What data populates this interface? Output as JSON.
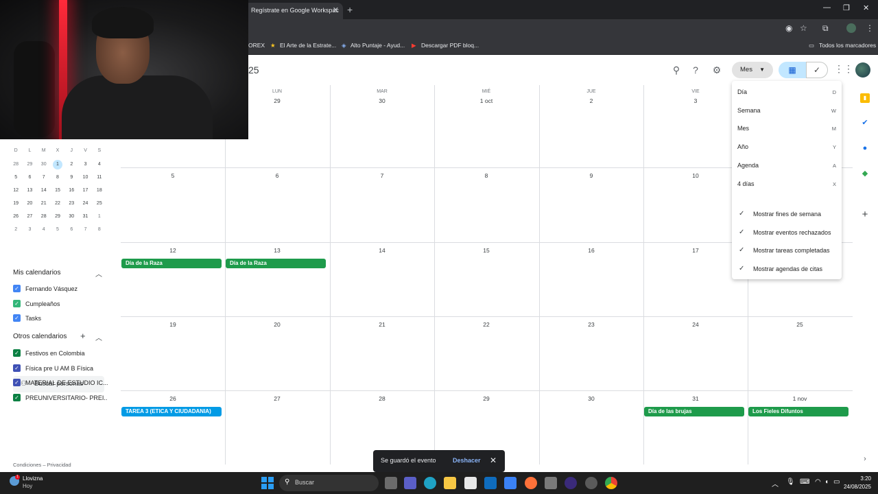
{
  "browser": {
    "active_tab_title": "Regístrate en Google Workspac",
    "bookmarks": [
      "OREX",
      "El Arte de la Estrate...",
      "Alto Puntaje - Ayud...",
      "Descargar PDF bloq..."
    ],
    "all_bookmarks": "Todos los marcadores"
  },
  "header": {
    "year_fragment": "25",
    "view_button": "Mes"
  },
  "mini_calendar": {
    "dow": [
      "D",
      "L",
      "M",
      "X",
      "J",
      "V",
      "S"
    ],
    "weeks": [
      [
        "28",
        "29",
        "30",
        "1",
        "2",
        "3",
        "4"
      ],
      [
        "5",
        "6",
        "7",
        "8",
        "9",
        "10",
        "11"
      ],
      [
        "12",
        "13",
        "14",
        "15",
        "16",
        "17",
        "18"
      ],
      [
        "19",
        "20",
        "21",
        "22",
        "23",
        "24",
        "25"
      ],
      [
        "26",
        "27",
        "28",
        "29",
        "30",
        "31",
        "1"
      ],
      [
        "2",
        "3",
        "4",
        "5",
        "6",
        "7",
        "8"
      ]
    ]
  },
  "sidebar": {
    "people_search": "Buscar personas",
    "my_calendars_title": "Mis calendarios",
    "my_calendars": [
      {
        "label": "Fernando Vásquez",
        "color": "#4285f4"
      },
      {
        "label": "Cumpleaños",
        "color": "#33b679"
      },
      {
        "label": "Tasks",
        "color": "#4285f4"
      }
    ],
    "other_calendars_title": "Otros calendarios",
    "other_calendars": [
      {
        "label": "Festivos en Colombia",
        "color": "#0b8043"
      },
      {
        "label": "Física pre U AM B Física",
        "color": "#3f51b5"
      },
      {
        "label": "MATERIAL DE ESTUDIO IC...",
        "color": "#3f51b5"
      },
      {
        "label": "PREUNIVERSITARIO- PREI...",
        "color": "#0b8043"
      }
    ],
    "footer": "Condiciones – Privacidad"
  },
  "grid": {
    "dow": [
      "",
      "LUN",
      "MAR",
      "MIÉ",
      "JUE",
      "VIE",
      ""
    ],
    "weeks": [
      [
        "",
        "29",
        "30",
        "1 oct",
        "2",
        "3",
        ""
      ],
      [
        "5",
        "6",
        "7",
        "8",
        "9",
        "10",
        ""
      ],
      [
        "12",
        "13",
        "14",
        "15",
        "16",
        "17",
        ""
      ],
      [
        "19",
        "20",
        "21",
        "22",
        "23",
        "24",
        "25"
      ],
      [
        "26",
        "27",
        "28",
        "29",
        "30",
        "31",
        "1 nov"
      ]
    ],
    "events": [
      {
        "title": "Día de la Raza",
        "week": 2,
        "day": 0,
        "type": "green"
      },
      {
        "title": "Día de la Raza",
        "week": 2,
        "day": 1,
        "type": "green"
      },
      {
        "title": "TAREA 3 (ETICA Y CIUDADANIA)",
        "week": 4,
        "day": 0,
        "type": "blue"
      },
      {
        "title": "Día de las brujas",
        "week": 4,
        "day": 5,
        "type": "green"
      },
      {
        "title": "Los Fieles Difuntos",
        "week": 4,
        "day": 6,
        "type": "green"
      }
    ]
  },
  "view_menu": {
    "items": [
      {
        "label": "Día",
        "key": "D"
      },
      {
        "label": "Semana",
        "key": "W"
      },
      {
        "label": "Mes",
        "key": "M"
      },
      {
        "label": "Año",
        "key": "Y"
      },
      {
        "label": "Agenda",
        "key": "A"
      },
      {
        "label": "4 días",
        "key": "X"
      }
    ],
    "options": [
      "Mostrar fines de semana",
      "Mostrar eventos rechazados",
      "Mostrar tareas completadas",
      "Mostrar agendas de citas"
    ]
  },
  "snackbar": {
    "message": "Se guardó el evento",
    "action": "Deshacer"
  },
  "taskbar": {
    "weather_temp": "Llovizna",
    "weather_desc": "Hoy",
    "search": "Buscar",
    "time": "3:20",
    "date": "24/08/2025"
  }
}
